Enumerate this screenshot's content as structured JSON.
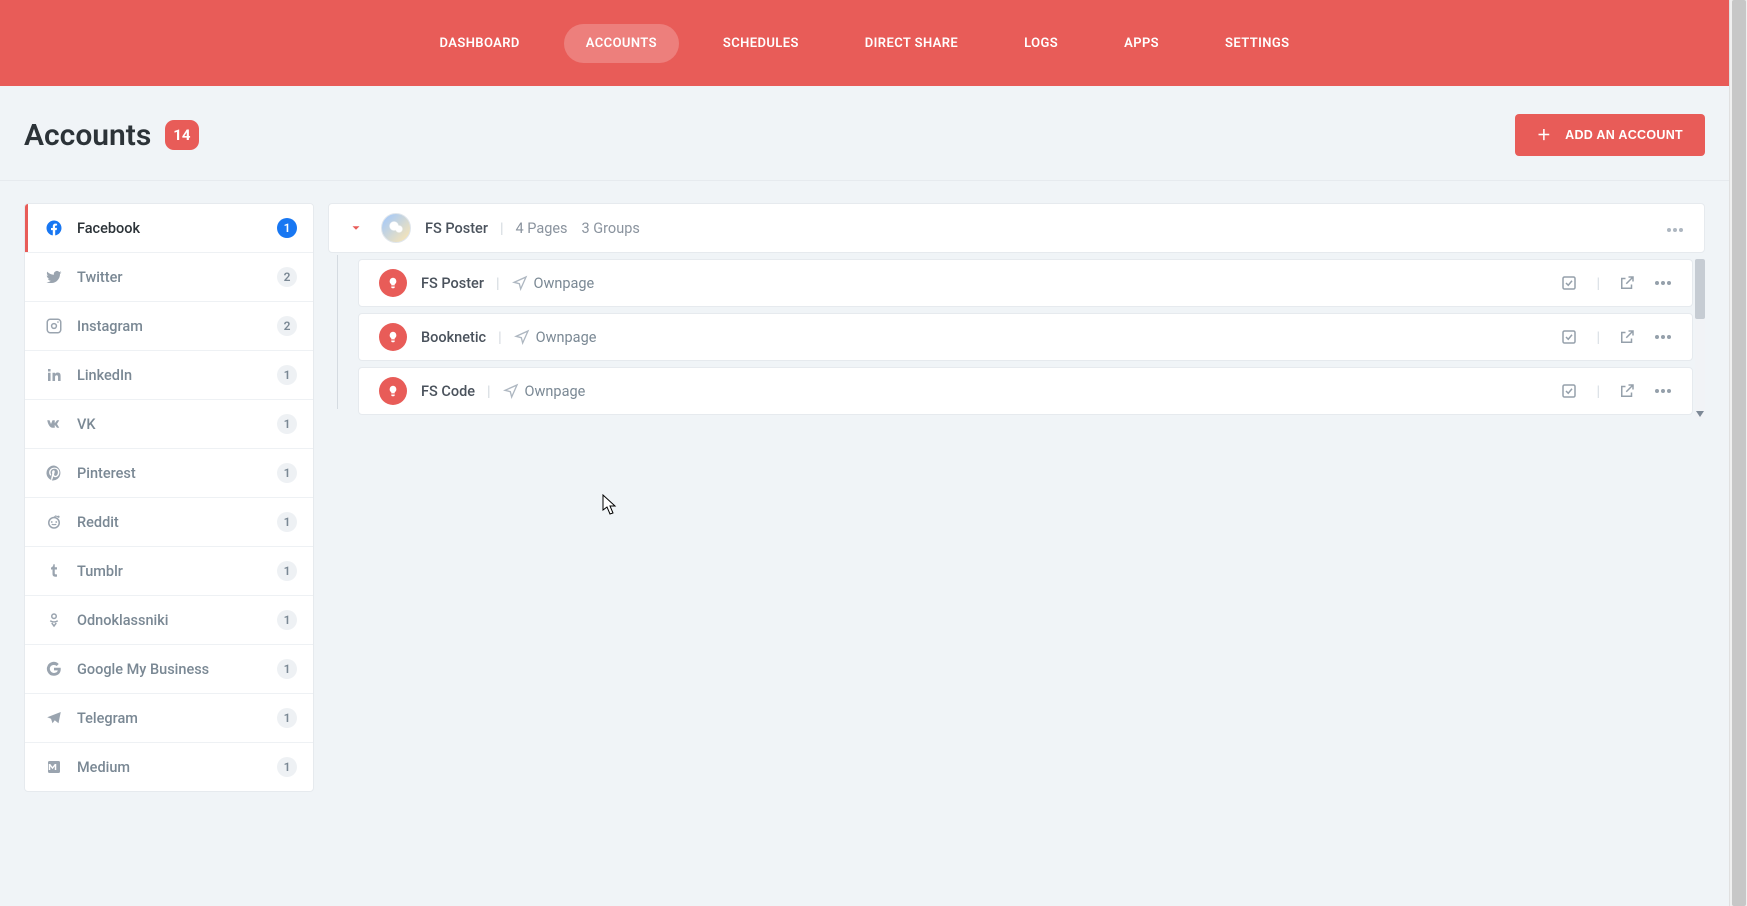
{
  "nav": {
    "items": [
      {
        "label": "DASHBOARD"
      },
      {
        "label": "ACCOUNTS",
        "active": true
      },
      {
        "label": "SCHEDULES"
      },
      {
        "label": "DIRECT SHARE"
      },
      {
        "label": "LOGS"
      },
      {
        "label": "APPS"
      },
      {
        "label": "SETTINGS"
      }
    ]
  },
  "header": {
    "title": "Accounts",
    "count": "14",
    "add_button": "ADD AN ACCOUNT"
  },
  "networks": [
    {
      "name": "Facebook",
      "count": "1",
      "active": true
    },
    {
      "name": "Twitter",
      "count": "2"
    },
    {
      "name": "Instagram",
      "count": "2"
    },
    {
      "name": "LinkedIn",
      "count": "1"
    },
    {
      "name": "VK",
      "count": "1"
    },
    {
      "name": "Pinterest",
      "count": "1"
    },
    {
      "name": "Reddit",
      "count": "1"
    },
    {
      "name": "Tumblr",
      "count": "1"
    },
    {
      "name": "Odnoklassniki",
      "count": "1"
    },
    {
      "name": "Google My Business",
      "count": "1"
    },
    {
      "name": "Telegram",
      "count": "1"
    },
    {
      "name": "Medium",
      "count": "1"
    }
  ],
  "account": {
    "name": "FS Poster",
    "pages": "4 Pages",
    "groups": "3 Groups"
  },
  "sub_items": [
    {
      "name": "FS Poster",
      "type": "Ownpage"
    },
    {
      "name": "Booknetic",
      "type": "Ownpage"
    },
    {
      "name": "FS Code",
      "type": "Ownpage"
    }
  ]
}
